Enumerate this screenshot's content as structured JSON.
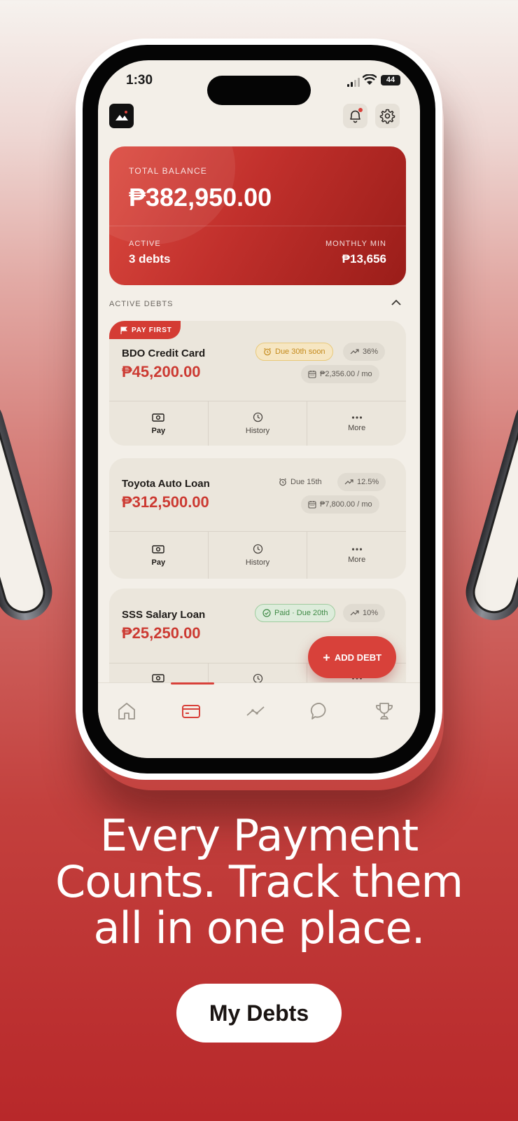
{
  "status_bar": {
    "time": "1:30",
    "battery": "44"
  },
  "balance": {
    "label": "TOTAL BALANCE",
    "amount": "₱382,950.00",
    "active_label": "ACTIVE",
    "active_value": "3 debts",
    "monthly_label": "MONTHLY MIN",
    "monthly_value": "₱13,656"
  },
  "section": {
    "title": "ACTIVE DEBTS"
  },
  "debts": [
    {
      "flag": "PAY FIRST",
      "name": "BDO Credit Card",
      "amount": "₱45,200.00",
      "due": "Due 30th soon",
      "rate": "36%",
      "monthly": "₱2,356.00 / mo",
      "actions": [
        "Pay",
        "History",
        "More"
      ]
    },
    {
      "name": "Toyota Auto Loan",
      "amount": "₱312,500.00",
      "due": "Due 15th",
      "rate": "12.5%",
      "monthly": "₱7,800.00 / mo",
      "actions": [
        "Pay",
        "History",
        "More"
      ]
    },
    {
      "name": "SSS Salary Loan",
      "amount": "₱25,250.00",
      "due": "Paid · Due 20th",
      "rate": "10%",
      "actions": [
        "Pay",
        "History",
        "More"
      ]
    }
  ],
  "fab": {
    "label": "ADD DEBT"
  },
  "tabs": [
    "home-icon",
    "card-icon",
    "trend-icon",
    "chat-icon",
    "trophy-icon"
  ],
  "promo": {
    "headline": "Every Payment Counts. Track them all in one place.",
    "pill": "My Debts"
  },
  "colors": {
    "accent": "#d8413a",
    "background": "#f3efe8"
  }
}
